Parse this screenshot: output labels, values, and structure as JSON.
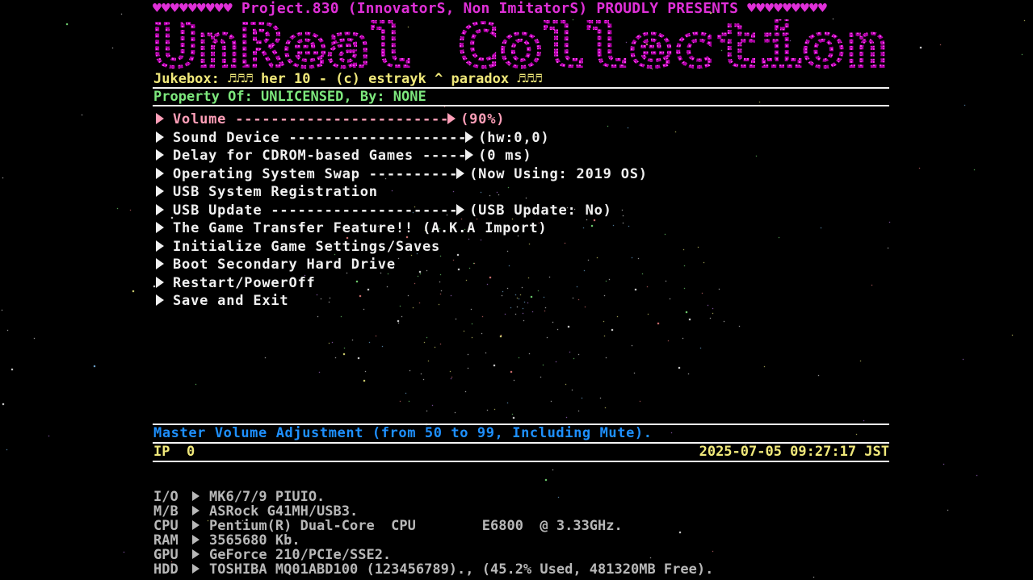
{
  "header": {
    "presents": "♥♥♥♥♥♥♥♥♥ Project.830 (InnovatorS, Non ImitatorS) PROUDLY PRESENTS ♥♥♥♥♥♥♥♥♥",
    "logo_text": "UnReal Collection"
  },
  "jukebox": "Jukebox: ♬♬♬ her 10 - (c) estrayk ^ paradox ♬♬♬",
  "property": "Property Of: UNLICENSED, By: NONE",
  "menu": [
    {
      "label": "Volume",
      "dashes": " ------------------------",
      "value": "(90%)",
      "selected": true
    },
    {
      "label": "Sound Device",
      "dashes": " --------------------",
      "value": "(hw:0,0)",
      "selected": false
    },
    {
      "label": "Delay for CDROM-based Games",
      "dashes": " -----",
      "value": "(0 ms)",
      "selected": false
    },
    {
      "label": "Operating System Swap",
      "dashes": " ----------",
      "value": "(Now Using: 2019 OS)",
      "selected": false
    },
    {
      "label": "USB System Registration",
      "dashes": "",
      "value": "",
      "selected": false
    },
    {
      "label": "USB Update",
      "dashes": " ---------------------",
      "value": "(USB Update: No)",
      "selected": false
    },
    {
      "label": "The Game Transfer Feature!! (A.K.A Import)",
      "dashes": "",
      "value": "",
      "selected": false
    },
    {
      "label": "Initialize Game Settings/Saves",
      "dashes": "",
      "value": "",
      "selected": false
    },
    {
      "label": "Boot Secondary Hard Drive",
      "dashes": "",
      "value": "",
      "selected": false
    },
    {
      "label": "Restart/PowerOff",
      "dashes": "",
      "value": "",
      "selected": false
    },
    {
      "label": "Save and Exit",
      "dashes": "",
      "value": "",
      "selected": false
    }
  ],
  "help_text": "Master Volume Adjustment (from 50 to 99, Including Mute).",
  "status": {
    "ip_label": "IP",
    "ip_value": "0",
    "datetime": "2025-07-05 09:27:17 JST"
  },
  "sysinfo": [
    {
      "key": "I/O",
      "value": "MK6/7/9 PIUIO."
    },
    {
      "key": "M/B",
      "value": "ASRock G41MH/USB3."
    },
    {
      "key": "CPU",
      "value": "Pentium(R) Dual-Core  CPU        E6800  @ 3.33GHz."
    },
    {
      "key": "RAM",
      "value": "3565680 Kb."
    },
    {
      "key": "GPU",
      "value": "GeForce 210/PCIe/SSE2."
    },
    {
      "key": "HDD",
      "value": "TOSHIBA MQ01ABD100 (123456789)., (45.2% Used, 481320MB Free)."
    }
  ],
  "colors": {
    "presents": "#e030d8",
    "logo": "#c020b0",
    "jukebox": "#f0e87a",
    "property": "#7de87d",
    "menu_text": "#f0f0f0",
    "menu_selected": "#ff9fb8",
    "help": "#1e90ff",
    "sysinfo": "#b8b8b8",
    "background": "#000000"
  }
}
